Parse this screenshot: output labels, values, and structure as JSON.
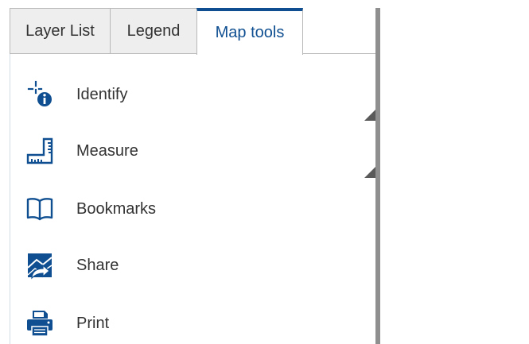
{
  "tabs": [
    {
      "label": "Layer List",
      "active": false
    },
    {
      "label": "Legend",
      "active": false
    },
    {
      "label": "Map tools",
      "active": true
    }
  ],
  "tools": [
    {
      "label": "Identify",
      "icon": "identify-icon"
    },
    {
      "label": "Measure",
      "icon": "ruler-icon"
    },
    {
      "label": "Bookmarks",
      "icon": "book-icon"
    },
    {
      "label": "Share",
      "icon": "share-map-icon"
    },
    {
      "label": "Print",
      "icon": "printer-icon"
    }
  ],
  "colors": {
    "accent": "#0f4f91",
    "text": "#333333",
    "tab_inactive_bg": "#eeeeee",
    "border": "#b8b8b8"
  }
}
